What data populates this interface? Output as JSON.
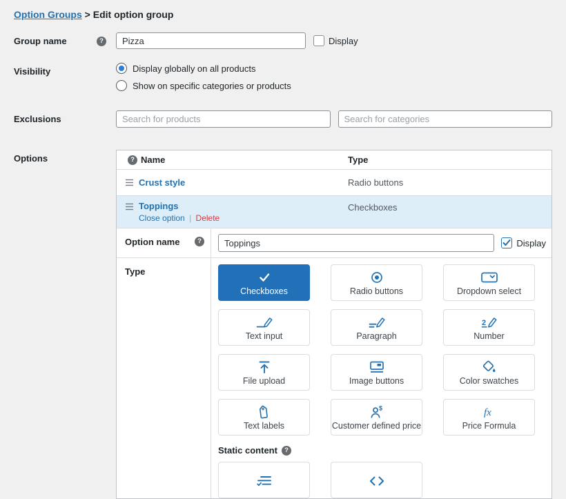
{
  "colors": {
    "accent": "#2271b1",
    "danger": "#d63638",
    "row_highlight": "#ddeef9",
    "page_background": "#f0f0f1"
  },
  "breadcrumb": {
    "link": "Option Groups",
    "separator": ">",
    "current": "Edit option group"
  },
  "group_name": {
    "label": "Group name",
    "value": "Pizza",
    "display_label": "Display",
    "display_checked": false
  },
  "visibility": {
    "label": "Visibility",
    "options": [
      {
        "label": "Display globally on all products",
        "selected": true
      },
      {
        "label": "Show on specific categories or products",
        "selected": false
      }
    ]
  },
  "exclusions": {
    "label": "Exclusions",
    "products_placeholder": "Search for products",
    "categories_placeholder": "Search for categories"
  },
  "options_section": {
    "label": "Options"
  },
  "options_table": {
    "name_header": "Name",
    "type_header": "Type",
    "rows": [
      {
        "name": "Crust style",
        "type": "Radio buttons",
        "expanded": false
      },
      {
        "name": "Toppings",
        "type": "Checkboxes",
        "expanded": true,
        "close_label": "Close option",
        "separator": "|",
        "delete_label": "Delete"
      }
    ]
  },
  "option_editor": {
    "option_name": {
      "label": "Option name",
      "value": "Toppings",
      "display_label": "Display",
      "display_checked": true
    },
    "type_section": {
      "label": "Type",
      "choices": [
        {
          "label": "Checkboxes",
          "icon": "checkboxes-icon",
          "selected": true
        },
        {
          "label": "Radio buttons",
          "icon": "radio-buttons-icon",
          "selected": false
        },
        {
          "label": "Dropdown select",
          "icon": "dropdown-select-icon",
          "selected": false
        },
        {
          "label": "Text input",
          "icon": "text-input-icon",
          "selected": false
        },
        {
          "label": "Paragraph",
          "icon": "paragraph-icon",
          "selected": false
        },
        {
          "label": "Number",
          "icon": "number-icon",
          "selected": false
        },
        {
          "label": "File upload",
          "icon": "file-upload-icon",
          "selected": false
        },
        {
          "label": "Image buttons",
          "icon": "image-buttons-icon",
          "selected": false
        },
        {
          "label": "Color swatches",
          "icon": "color-swatches-icon",
          "selected": false
        },
        {
          "label": "Text labels",
          "icon": "text-labels-icon",
          "selected": false
        },
        {
          "label": "Customer defined price",
          "icon": "customer-defined-price-icon",
          "selected": false
        },
        {
          "label": "Price Formula",
          "icon": "price-formula-icon",
          "selected": false
        }
      ],
      "static_heading": "Static content"
    }
  }
}
